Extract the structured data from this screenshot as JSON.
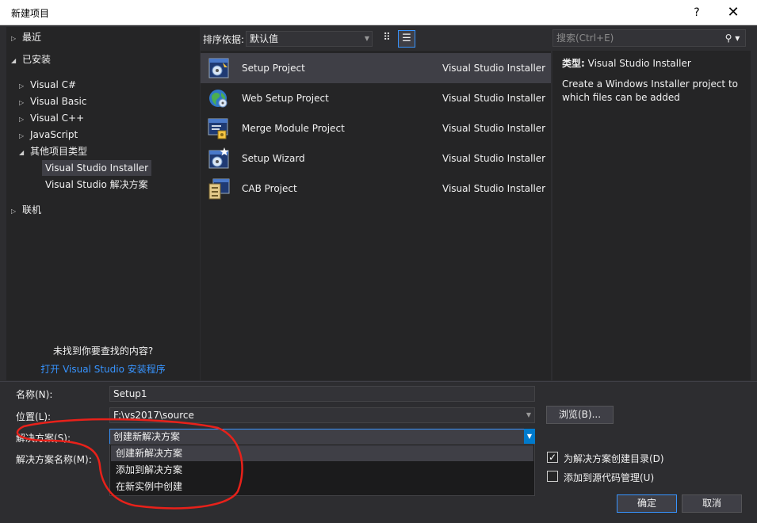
{
  "window": {
    "title": "新建项目",
    "help": "?",
    "close": "✕"
  },
  "nav": {
    "recent": "最近",
    "installed": "已安装",
    "vcsharp": "Visual C#",
    "vbasic": "Visual Basic",
    "vcpp": "Visual C++",
    "javascript": "JavaScript",
    "other": "其他项目类型",
    "vsinstaller": "Visual Studio Installer",
    "vssolutions": "Visual Studio 解决方案",
    "online": "联机",
    "not_found": "未找到你要查找的内容?",
    "install_link": "打开 Visual Studio 安装程序"
  },
  "sort": {
    "label": "排序依据:",
    "value": "默认值"
  },
  "templates": [
    {
      "name": "Setup Project",
      "category": "Visual Studio Installer",
      "icon": "setup-project-icon"
    },
    {
      "name": "Web Setup Project",
      "category": "Visual Studio Installer",
      "icon": "web-setup-project-icon"
    },
    {
      "name": "Merge Module Project",
      "category": "Visual Studio Installer",
      "icon": "merge-module-project-icon"
    },
    {
      "name": "Setup Wizard",
      "category": "Visual Studio Installer",
      "icon": "setup-wizard-icon"
    },
    {
      "name": "CAB Project",
      "category": "Visual Studio Installer",
      "icon": "cab-project-icon"
    }
  ],
  "search": {
    "placeholder": "搜索(Ctrl+E)"
  },
  "detail": {
    "type_label": "类型:",
    "type_value": "Visual Studio Installer",
    "description": "Create a Windows Installer project to which files can be added"
  },
  "form": {
    "name_label": "名称(N):",
    "name_value": "Setup1",
    "location_label": "位置(L):",
    "location_value": "F:\\vs2017\\source",
    "browse": "浏览(B)...",
    "solution_label": "解决方案(S):",
    "solution_value": "创建新解决方案",
    "solution_name_label": "解决方案名称(M):",
    "solution_options": [
      "创建新解决方案",
      "添加到解决方案",
      "在新实例中创建"
    ],
    "create_dir_label": "为解决方案创建目录(D)",
    "create_dir_checked": true,
    "source_control_label": "添加到源代码管理(U)",
    "source_control_checked": false,
    "ok": "确定",
    "cancel": "取消"
  },
  "colors": {
    "accent": "#007acc",
    "link": "#3794ff",
    "annotation": "#e8211a"
  }
}
